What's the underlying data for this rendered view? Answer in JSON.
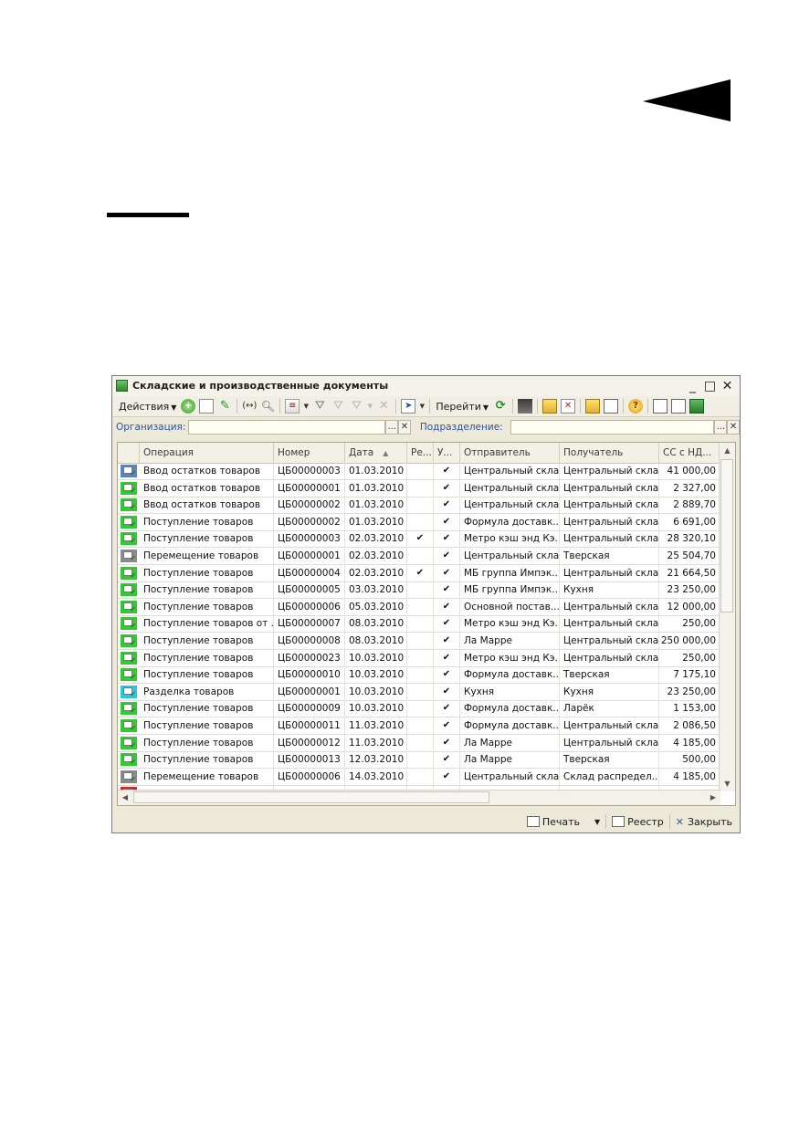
{
  "window": {
    "title": "Складские и производственные документы",
    "controls": [
      "_",
      "□",
      "✕"
    ]
  },
  "toolbar": {
    "actions_label": "Действия",
    "goto_label": "Перейти",
    "icons": [
      "add-icon",
      "copy-icon",
      "edit-icon",
      "interval-icon",
      "search-icon",
      "sort-icon",
      "filter-icon",
      "filter-clear-icon",
      "filter-list-icon",
      "filter-off-icon",
      "post-icon",
      "refresh-icon",
      "structure-icon",
      "upload-icon",
      "delete-icon",
      "table-settings-icon",
      "table-icon",
      "help-icon",
      "tree-icon",
      "list-icon",
      "excel-icon"
    ]
  },
  "filters": {
    "organization_label": "Организация:",
    "organization_value": "",
    "division_label": "Подразделение:",
    "division_value": "",
    "select_button": "...",
    "clear_button": "✕"
  },
  "table": {
    "columns": [
      "Операция",
      "Номер",
      "Дата",
      "Ре...",
      "У...",
      "Отправитель",
      "Получатель",
      "СС с НД..."
    ],
    "rows": [
      {
        "icon": "blue",
        "operation": "Ввод остатков товаров",
        "number": "ЦБ00000003",
        "date": "01.03.2010",
        "re": "",
        "u": "✔",
        "sender": "Центральный склад",
        "receiver": "Центральный склад",
        "amount": "41 000,00"
      },
      {
        "icon": "green",
        "operation": "Ввод остатков товаров",
        "number": "ЦБ00000001",
        "date": "01.03.2010",
        "re": "",
        "u": "✔",
        "sender": "Центральный склад",
        "receiver": "Центральный склад",
        "amount": "2 327,00"
      },
      {
        "icon": "green",
        "operation": "Ввод остатков товаров",
        "number": "ЦБ00000002",
        "date": "01.03.2010",
        "re": "",
        "u": "✔",
        "sender": "Центральный склад",
        "receiver": "Центральный склад",
        "amount": "2 889,70"
      },
      {
        "icon": "green",
        "operation": "Поступление товаров",
        "number": "ЦБ00000002",
        "date": "01.03.2010",
        "re": "",
        "u": "✔",
        "sender": "Формула доставк...",
        "receiver": "Центральный склад",
        "amount": "6 691,00"
      },
      {
        "icon": "green",
        "operation": "Поступление товаров",
        "number": "ЦБ00000003",
        "date": "02.03.2010",
        "re": "✔",
        "u": "✔",
        "sender": "Метро кэш энд Кэ...",
        "receiver": "Центральный склад",
        "amount": "28 320,10"
      },
      {
        "icon": "gray",
        "operation": "Перемещение товаров",
        "number": "ЦБ00000001",
        "date": "02.03.2010",
        "re": "",
        "u": "✔",
        "sender": "Центральный склад",
        "receiver": "Тверская",
        "amount": "25 504,70"
      },
      {
        "icon": "green",
        "operation": "Поступление товаров",
        "number": "ЦБ00000004",
        "date": "02.03.2010",
        "re": "✔",
        "u": "✔",
        "sender": "МБ группа Импэк...",
        "receiver": "Центральный склад",
        "amount": "21 664,50"
      },
      {
        "icon": "green",
        "operation": "Поступление товаров",
        "number": "ЦБ00000005",
        "date": "03.03.2010",
        "re": "",
        "u": "✔",
        "sender": "МБ группа Импэк...",
        "receiver": "Кухня",
        "amount": "23 250,00"
      },
      {
        "icon": "green",
        "operation": "Поступление товаров",
        "number": "ЦБ00000006",
        "date": "05.03.2010",
        "re": "",
        "u": "✔",
        "sender": "Основной постав...",
        "receiver": "Центральный склад",
        "amount": "12 000,00"
      },
      {
        "icon": "green",
        "operation": "Поступление товаров от ...",
        "number": "ЦБ00000007",
        "date": "08.03.2010",
        "re": "",
        "u": "✔",
        "sender": "Метро кэш энд Кэ...",
        "receiver": "Центральный склад",
        "amount": "250,00"
      },
      {
        "icon": "green",
        "operation": "Поступление товаров",
        "number": "ЦБ00000008",
        "date": "08.03.2010",
        "re": "",
        "u": "✔",
        "sender": "Ла Марре",
        "receiver": "Центральный склад",
        "amount": "250 000,00"
      },
      {
        "icon": "green",
        "operation": "Поступление товаров",
        "number": "ЦБ00000023",
        "date": "10.03.2010",
        "re": "",
        "u": "✔",
        "sender": "Метро кэш энд Кэ...",
        "receiver": "Центральный склад",
        "amount": "250,00"
      },
      {
        "icon": "green",
        "operation": "Поступление товаров",
        "number": "ЦБ00000010",
        "date": "10.03.2010",
        "re": "",
        "u": "✔",
        "sender": "Формула доставк...",
        "receiver": "Тверская",
        "amount": "7 175,10"
      },
      {
        "icon": "cyan",
        "operation": "Разделка товаров",
        "number": "ЦБ00000001",
        "date": "10.03.2010",
        "re": "",
        "u": "✔",
        "sender": "Кухня",
        "receiver": "Кухня",
        "amount": "23 250,00"
      },
      {
        "icon": "green",
        "operation": "Поступление товаров",
        "number": "ЦБ00000009",
        "date": "10.03.2010",
        "re": "",
        "u": "✔",
        "sender": "Формула доставк...",
        "receiver": "Ларёк",
        "amount": "1 153,00"
      },
      {
        "icon": "green",
        "operation": "Поступление товаров",
        "number": "ЦБ00000011",
        "date": "11.03.2010",
        "re": "",
        "u": "✔",
        "sender": "Формула доставк...",
        "receiver": "Центральный склад",
        "amount": "2 086,50"
      },
      {
        "icon": "green",
        "operation": "Поступление товаров",
        "number": "ЦБ00000012",
        "date": "11.03.2010",
        "re": "",
        "u": "✔",
        "sender": "Ла Марре",
        "receiver": "Центральный склад",
        "amount": "4 185,00"
      },
      {
        "icon": "green",
        "operation": "Поступление товаров",
        "number": "ЦБ00000013",
        "date": "12.03.2010",
        "re": "",
        "u": "✔",
        "sender": "Ла Марре",
        "receiver": "Тверская",
        "amount": "500,00"
      },
      {
        "icon": "gray",
        "operation": "Перемещение товаров",
        "number": "ЦБ00000006",
        "date": "14.03.2010",
        "re": "",
        "u": "✔",
        "sender": "Центральный склад",
        "receiver": "Склад распредел...",
        "amount": "4 185,00"
      },
      {
        "icon": "red",
        "operation": "",
        "number": "",
        "date": "",
        "re": "",
        "u": "",
        "sender": "",
        "receiver": "",
        "amount": ""
      }
    ]
  },
  "footer": {
    "print_label": "Печать",
    "registry_label": "Реестр",
    "close_label": "Закрыть"
  },
  "colors": {
    "icon_green": "#2ecc2e",
    "icon_blue": "#5a82c8",
    "icon_gray": "#8a8a8a",
    "icon_cyan": "#28c8e0",
    "icon_red": "#e02020",
    "label_blue": "#3050a0"
  }
}
